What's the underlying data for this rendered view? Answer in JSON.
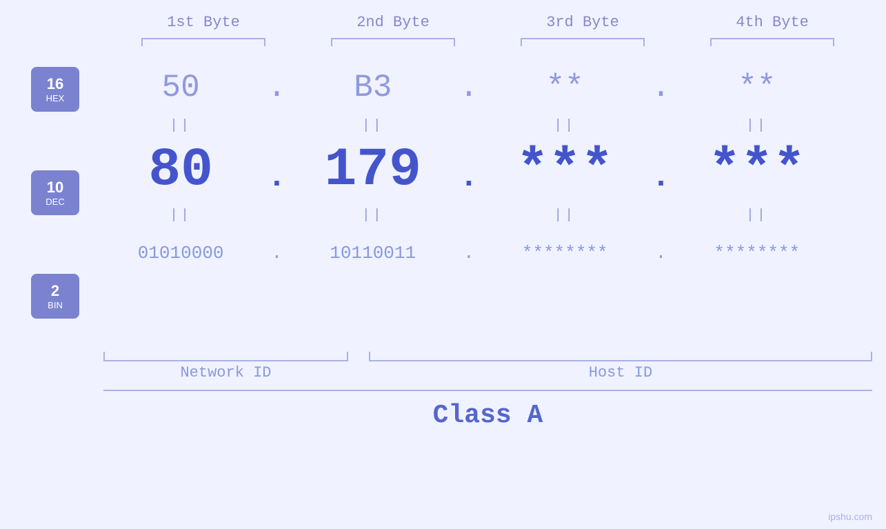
{
  "headers": {
    "col1": "1st Byte",
    "col2": "2nd Byte",
    "col3": "3rd Byte",
    "col4": "4th Byte"
  },
  "labels": {
    "hex": {
      "num": "16",
      "base": "HEX"
    },
    "dec": {
      "num": "10",
      "base": "DEC"
    },
    "bin": {
      "num": "2",
      "base": "BIN"
    }
  },
  "rows": {
    "hex": {
      "b1": "50",
      "b2": "B3",
      "b3": "**",
      "b4": "**",
      "dot": "."
    },
    "dec": {
      "b1": "80",
      "b2": "179",
      "b3": "***",
      "b4": "***",
      "dot": "."
    },
    "bin": {
      "b1": "01010000",
      "b2": "10110011",
      "b3": "********",
      "b4": "********",
      "dot": "."
    }
  },
  "network_label": "Network ID",
  "host_label": "Host ID",
  "class_label": "Class A",
  "watermark": "ipshu.com"
}
